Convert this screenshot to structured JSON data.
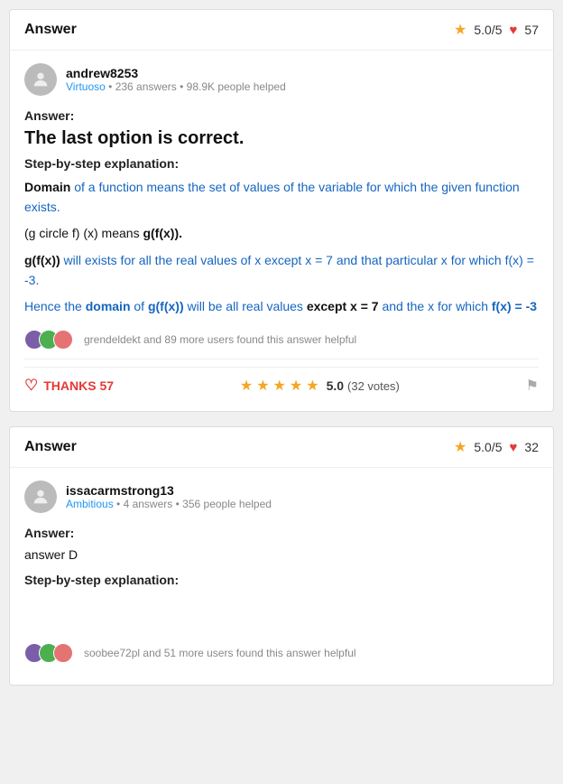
{
  "card1": {
    "header": {
      "title": "Answer",
      "rating": "5.0/5",
      "heart_count": "57"
    },
    "user": {
      "name": "andrew8253",
      "badge": "Virtuoso",
      "answers": "236 answers",
      "helped": "98.9K people helped"
    },
    "answer_label": "Answer:",
    "main_text": "The last option is correct.",
    "step_label": "Step-by-step explanation:",
    "paragraphs": [
      {
        "id": "p1",
        "text": "Domain of a function means the set of values of the variable for which the given function exists."
      },
      {
        "id": "p2",
        "text": "(g circle f) (x) means g(f(x))."
      },
      {
        "id": "p3",
        "text": "g(f(x)) will exists for all the real values of x except x = 7 and that particular x for which f(x) = -3."
      },
      {
        "id": "p4",
        "text": "Hence the domain of g(f(x)) will be all real values except x = 7 and the x for which f(x) = -3"
      }
    ],
    "helpful": {
      "text": "grendeldekt and 89 more users found this answer helpful"
    },
    "thanks_label": "THANKS 57",
    "rating_value": "5.0",
    "votes": "(32 votes)"
  },
  "card2": {
    "header": {
      "title": "Answer",
      "rating": "5.0/5",
      "heart_count": "32"
    },
    "user": {
      "name": "issacarmstrong13",
      "badge": "Ambitious",
      "answers": "4 answers",
      "helped": "356 people helped"
    },
    "answer_label": "Answer:",
    "answer_text": "answer D",
    "step_label": "Step-by-step explanation:",
    "helpful": {
      "text": "soobee72pl and 51 more users found this answer helpful"
    }
  }
}
